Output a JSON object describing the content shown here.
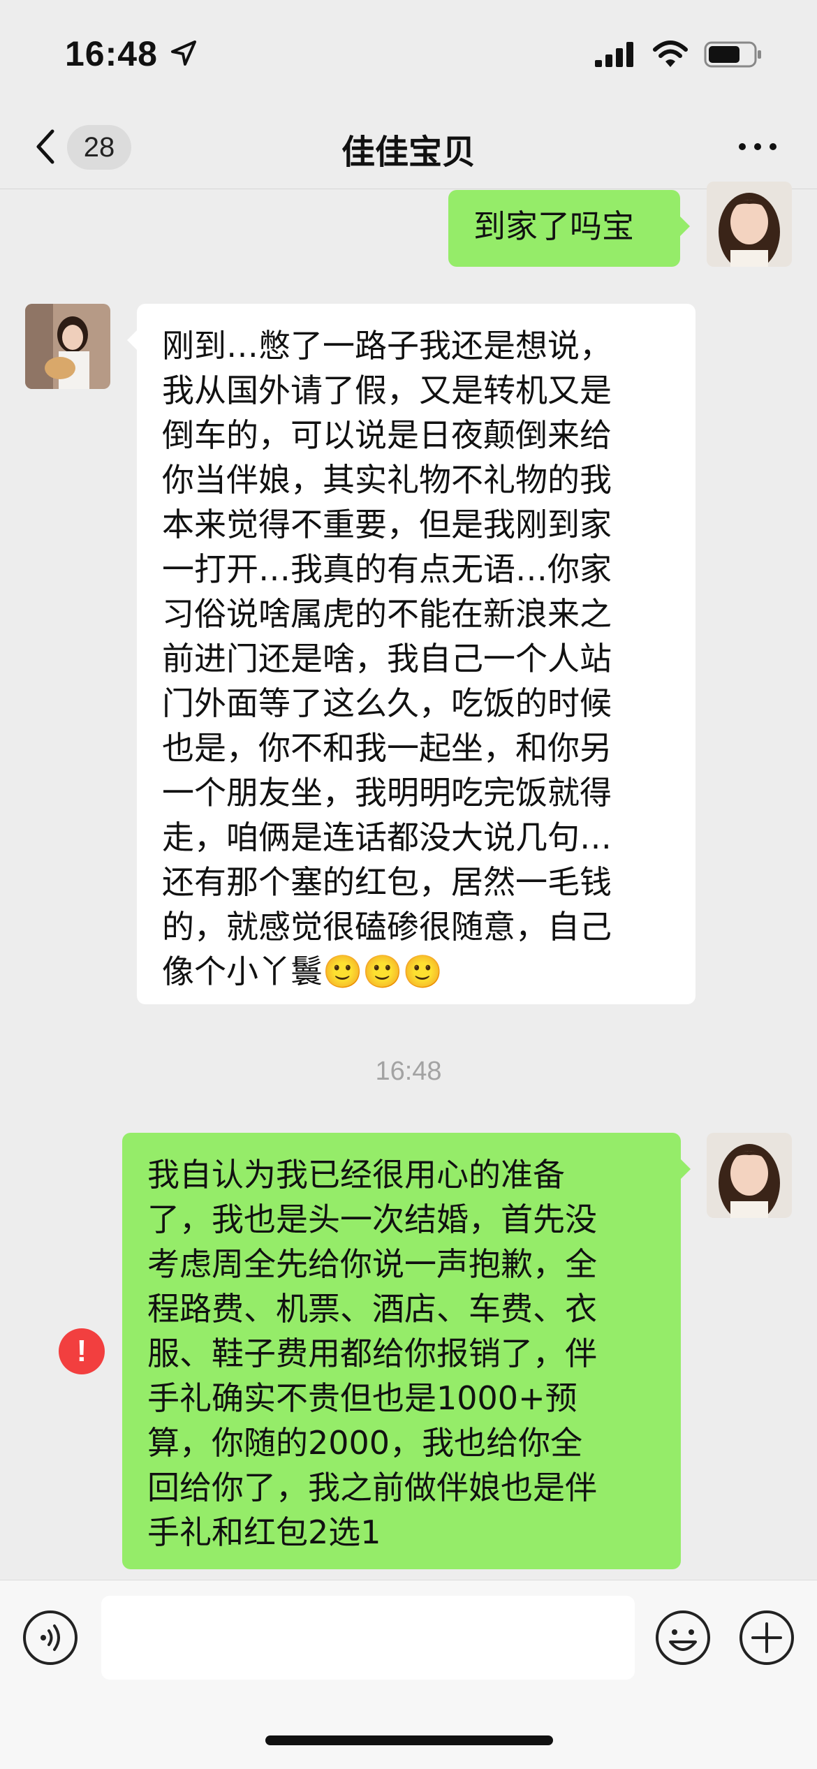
{
  "status_bar": {
    "time": "16:48"
  },
  "nav": {
    "unread_count": "28",
    "title": "佳佳宝贝"
  },
  "messages": [
    {
      "side": "outgoing",
      "text": "到家了吗宝"
    },
    {
      "side": "incoming",
      "text": "刚到…憋了一路子我还是想说，\n我从国外请了假，又是转机又是\n倒车的，可以说是日夜颠倒来给\n你当伴娘，其实礼物不礼物的我\n本来觉得不重要，但是我刚到家\n一打开…我真的有点无语…你家\n习俗说啥属虎的不能在新浪来之\n前进门还是啥，我自己一个人站\n门外面等了这么久，吃饭的时候\n也是，你不和我一起坐，和你另\n一个朋友坐，我明明吃完饭就得\n走，咱俩是连话都没大说几句…\n还有那个塞的红包，居然一毛钱\n的，就感觉很磕碜很随意，自己\n像个小丫鬟🙂🙂🙂"
    },
    {
      "side": "outgoing",
      "text": "我自认为我已经很用心的准备\n了，我也是头一次结婚，首先没\n考虑周全先给你说一声抱歉，全\n程路费、机票、酒店、车费、衣\n服、鞋子费用都给你报销了，伴\n手礼确实不贵但也是1000+预\n算，你随的2000，我也给你全\n回给你了，我之前做伴娘也是伴\n手礼和红包2选1",
      "failed": true
    }
  ],
  "time_divider": "16:48",
  "error_mark": "!",
  "input": {
    "value": ""
  },
  "colors": {
    "outgoing_bubble": "#95ec69",
    "incoming_bubble": "#ffffff",
    "background": "#ededed",
    "error": "#f23f3f"
  },
  "icons": [
    "location-arrow-icon",
    "signal-icon",
    "wifi-icon",
    "battery-icon",
    "back-chevron-icon",
    "more-dots-icon",
    "voice-icon",
    "emoji-icon",
    "plus-icon",
    "error-icon"
  ]
}
